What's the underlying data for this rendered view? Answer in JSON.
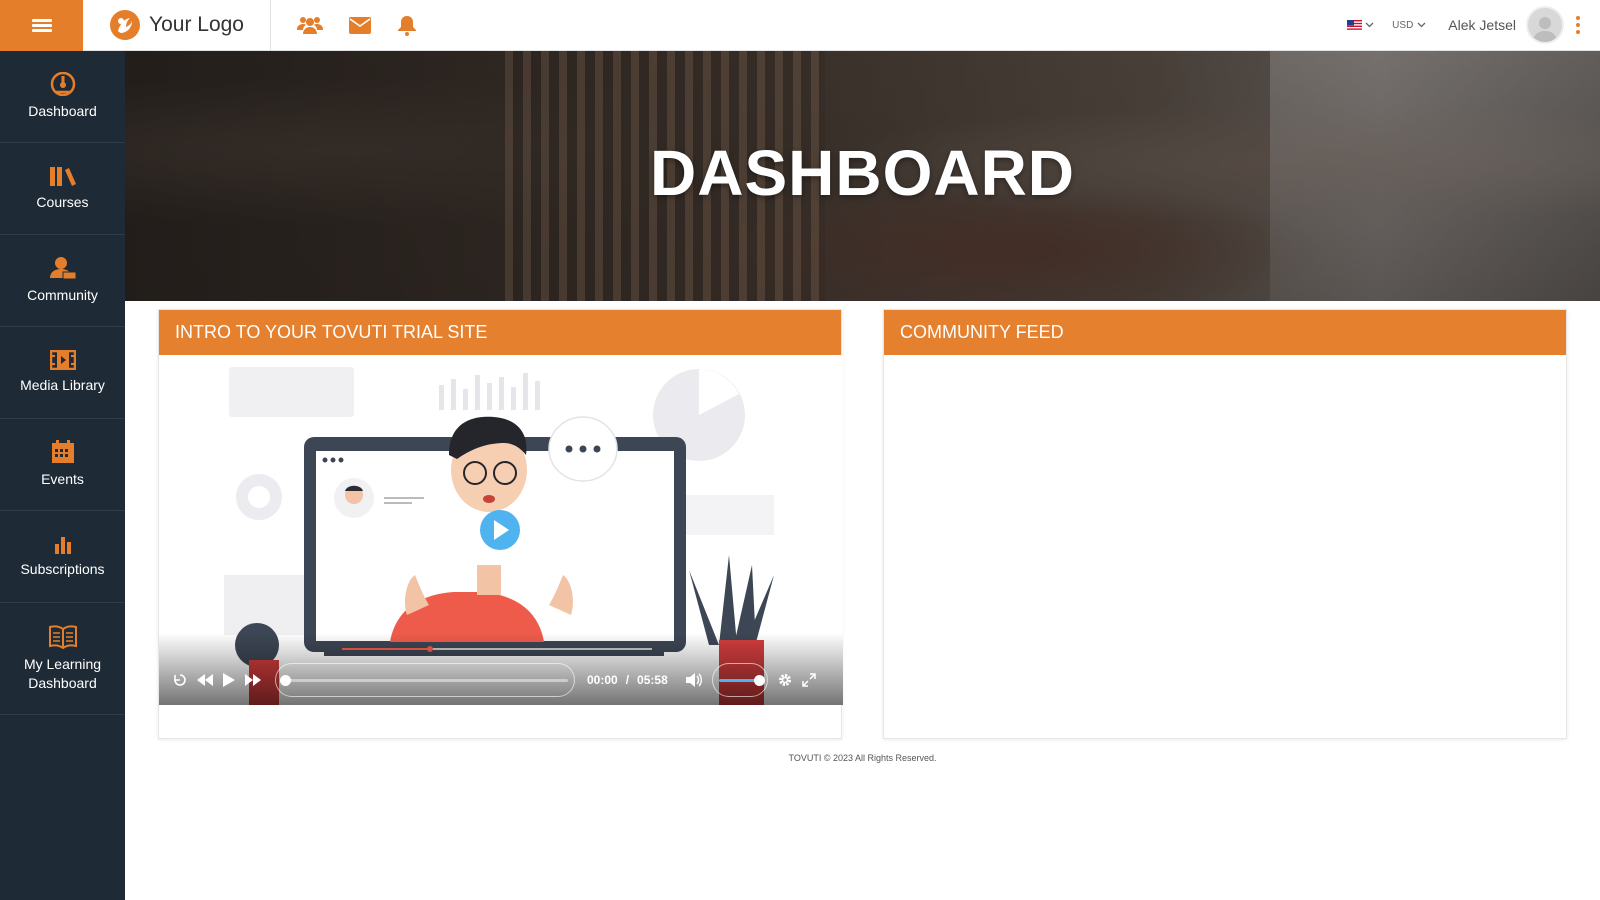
{
  "header": {
    "logo_text": "Your Logo",
    "currency": "USD",
    "user_name": "Alek Jetsel",
    "icons": [
      "users-icon",
      "mail-icon",
      "bell-icon"
    ],
    "accent_color": "#e57e2b"
  },
  "sidebar": {
    "items": [
      {
        "label": "Dashboard",
        "icon": "dashboard-gauge-icon"
      },
      {
        "label": "Courses",
        "icon": "books-icon"
      },
      {
        "label": "Community",
        "icon": "community-icon"
      },
      {
        "label": "Media Library",
        "icon": "film-icon"
      },
      {
        "label": "Events",
        "icon": "calendar-icon"
      },
      {
        "label": "Subscriptions",
        "icon": "bar-chart-icon"
      },
      {
        "label": "My Learning Dashboard",
        "label_line1": "My Learning",
        "label_line2": "Dashboard",
        "icon": "open-book-icon"
      }
    ],
    "background": "#1e2a36"
  },
  "hero": {
    "title": "DASHBOARD"
  },
  "intro_card": {
    "title": "INTRO TO YOUR TOVUTI TRIAL SITE",
    "video": {
      "current_time": "00:00",
      "separator": "/",
      "duration": "05:58",
      "progress_fraction": 0,
      "volume_fraction": 1
    }
  },
  "feed_card": {
    "title": "COMMUNITY FEED"
  },
  "footer": {
    "text": "TOVUTI © 2023 All Rights Reserved."
  }
}
